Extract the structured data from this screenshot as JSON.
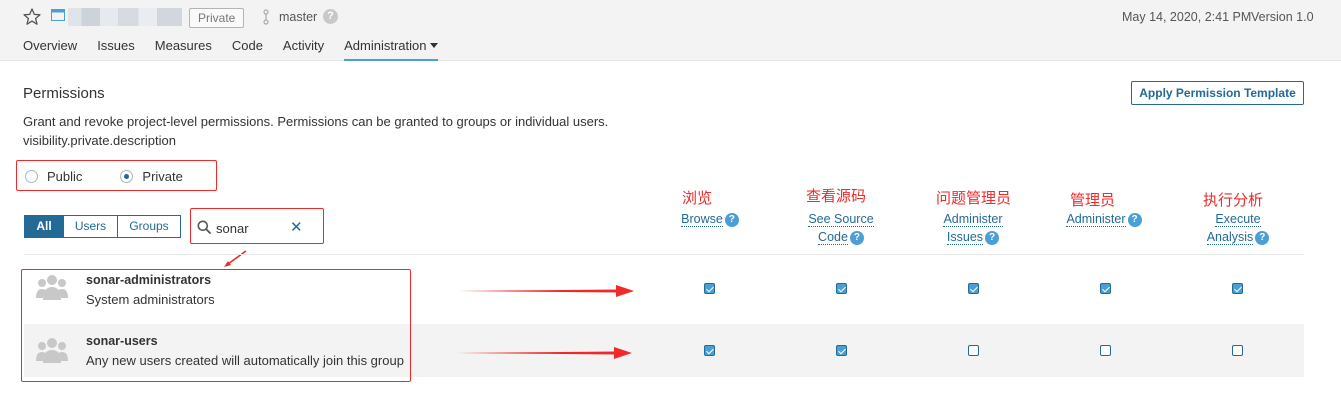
{
  "header": {
    "branch": "master",
    "visibility_badge": "Private",
    "help_symbol": "?",
    "date": "May 14, 2020, 2:41 PM",
    "version": "Version 1.0"
  },
  "nav": {
    "tabs": [
      "Overview",
      "Issues",
      "Measures",
      "Code",
      "Activity",
      "Administration"
    ],
    "active": "Administration"
  },
  "page": {
    "title": "Permissions",
    "description": "Grant and revoke project-level permissions. Permissions can be granted to groups or individual users.",
    "description_key": "visibility.private.description",
    "apply_template_button": "Apply Permission Template"
  },
  "visibility": {
    "options": [
      {
        "label": "Public",
        "checked": false
      },
      {
        "label": "Private",
        "checked": true
      }
    ]
  },
  "filter": {
    "buttons": [
      "All",
      "Users",
      "Groups"
    ],
    "active": "All",
    "search_value": "sonar",
    "clear_symbol": "✕"
  },
  "columns": [
    {
      "annotation": "浏览",
      "line1": "Browse",
      "line2": ""
    },
    {
      "annotation": "查看源码",
      "line1": "See Source",
      "line2": "Code"
    },
    {
      "annotation": "问题管理员",
      "line1": "Administer",
      "line2": "Issues"
    },
    {
      "annotation": "管理员",
      "line1": "Administer",
      "line2": ""
    },
    {
      "annotation": "执行分析",
      "line1": "Execute",
      "line2": "Analysis"
    }
  ],
  "rows": [
    {
      "name": "sonar-administrators",
      "description": "System administrators",
      "permissions": [
        true,
        true,
        true,
        true,
        true
      ]
    },
    {
      "name": "sonar-users",
      "description": "Any new users created will automatically join this group",
      "permissions": [
        true,
        true,
        false,
        false,
        false
      ]
    }
  ],
  "colors": {
    "accent": "#236a97",
    "accent_light": "#4b9fd5",
    "annotation_red": "#ee2a2a"
  }
}
